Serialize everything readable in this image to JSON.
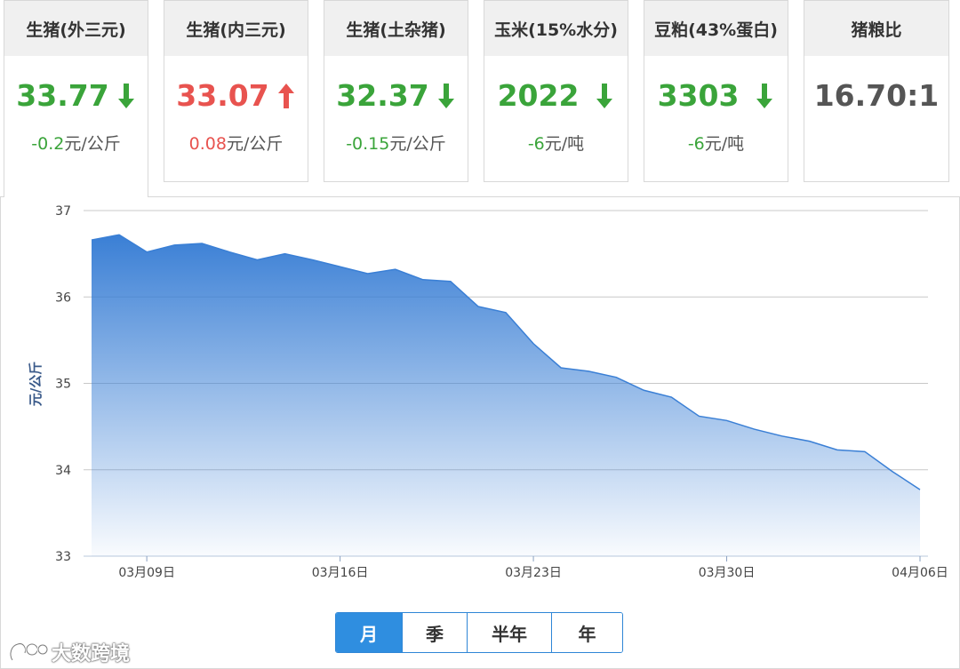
{
  "cards": [
    {
      "title": "生猪(外三元)",
      "price": "33.77",
      "direction": "down",
      "change": "-0.2",
      "unit": "元/公斤",
      "color": "#3aa43a"
    },
    {
      "title": "生猪(内三元)",
      "price": "33.07",
      "direction": "up",
      "change": "0.08",
      "unit": "元/公斤",
      "color": "#e8534f"
    },
    {
      "title": "生猪(土杂猪)",
      "price": "32.37",
      "direction": "down",
      "change": "-0.15",
      "unit": "元/公斤",
      "color": "#3aa43a"
    },
    {
      "title": "玉米(15%水分)",
      "price": "2022",
      "direction": "down",
      "change": "-6",
      "unit": "元/吨",
      "color": "#3aa43a"
    },
    {
      "title": "豆粕(43%蛋白)",
      "price": "3303",
      "direction": "down",
      "change": "-6",
      "unit": "元/吨",
      "color": "#3aa43a"
    },
    {
      "title": "猪粮比",
      "price": "16.70:1",
      "direction": "none",
      "change": "",
      "unit": "",
      "color": "#555555"
    }
  ],
  "active_card_index": 0,
  "chart_data": {
    "type": "area",
    "ylabel": "元/公斤",
    "ylim": [
      33,
      37
    ],
    "yticks": [
      33,
      34,
      35,
      36,
      37
    ],
    "xlim": [
      "03月07日",
      "04月06日"
    ],
    "xticks": [
      "03月09日",
      "03月16日",
      "03月23日",
      "03月30日",
      "04月06日"
    ],
    "grid": true,
    "color": "#3a7fd5",
    "series": [
      {
        "x": [
          "03月07日",
          "03月08日",
          "03月09日",
          "03月10日",
          "03月11日",
          "03月12日",
          "03月13日",
          "03月14日",
          "03月15日",
          "03月16日",
          "03月17日",
          "03月18日",
          "03月19日",
          "03月20日",
          "03月21日",
          "03月22日",
          "03月23日",
          "03月24日",
          "03月25日",
          "03月26日",
          "03月27日",
          "03月28日",
          "03月29日",
          "03月30日",
          "03月31日",
          "04月01日",
          "04月02日",
          "04月03日",
          "04月04日",
          "04月05日",
          "04月06日"
        ],
        "values": [
          36.66,
          36.72,
          36.52,
          36.6,
          36.62,
          36.52,
          36.43,
          36.5,
          36.43,
          36.35,
          36.27,
          36.32,
          36.2,
          36.18,
          35.89,
          35.82,
          35.46,
          35.18,
          35.14,
          35.07,
          34.92,
          34.84,
          34.62,
          34.57,
          34.47,
          34.39,
          34.33,
          34.23,
          34.21,
          33.98,
          33.77
        ]
      }
    ]
  },
  "range_tabs": [
    {
      "label": "月",
      "selected": true
    },
    {
      "label": "季",
      "selected": false
    },
    {
      "label": "半年",
      "selected": false
    },
    {
      "label": "年",
      "selected": false
    }
  ],
  "watermark": {
    "text": "大数跨境"
  },
  "icons": {
    "down": "arrow-down-icon",
    "up": "arrow-up-icon"
  }
}
